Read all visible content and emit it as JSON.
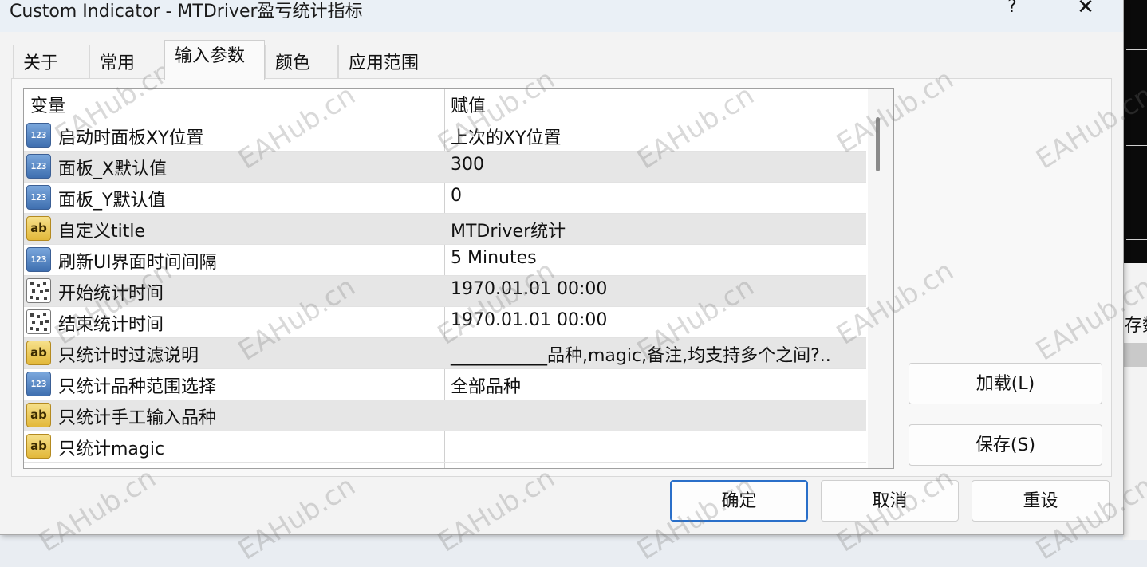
{
  "window": {
    "title": "Custom Indicator - MTDriver盈亏统计指标",
    "help_label": "?",
    "close_label": "✕"
  },
  "tabs": [
    {
      "label": "关于"
    },
    {
      "label": "常用"
    },
    {
      "label": "输入参数",
      "active": true
    },
    {
      "label": "颜色"
    },
    {
      "label": "应用范围"
    }
  ],
  "table": {
    "headers": {
      "variable": "变量",
      "value": "赋值"
    },
    "rows": [
      {
        "icon": "number-icon",
        "name": "启动时面板XY位置",
        "value": "上次的XY位置"
      },
      {
        "icon": "number-icon",
        "name": "面板_X默认值",
        "value": "300"
      },
      {
        "icon": "number-icon",
        "name": "面板_Y默认值",
        "value": "0"
      },
      {
        "icon": "string-icon",
        "name": "自定义title",
        "value": "MTDriver统计"
      },
      {
        "icon": "number-icon",
        "name": "刷新UI界面时间间隔",
        "value": "5 Minutes"
      },
      {
        "icon": "datetime-icon",
        "name": "开始统计时间",
        "value": "1970.01.01 00:00"
      },
      {
        "icon": "datetime-icon",
        "name": "结束统计时间",
        "value": "1970.01.01 00:00"
      },
      {
        "icon": "string-icon",
        "name": "只统计时过滤说明",
        "value": "___________品种,magic,备注,均支持多个之间?.."
      },
      {
        "icon": "number-icon",
        "name": "只统计品种范围选择",
        "value": "全部品种"
      },
      {
        "icon": "string-icon",
        "name": "只统计手工输入品种",
        "value": ""
      },
      {
        "icon": "string-icon",
        "name": "只统计magic",
        "value": ""
      }
    ]
  },
  "icon_glyphs": {
    "number": "123",
    "string": "ab"
  },
  "side_buttons": {
    "load": "加载(L)",
    "save": "保存(S)"
  },
  "footer_buttons": {
    "ok": "确定",
    "cancel": "取消",
    "reset": "重设"
  },
  "background_app": {
    "partial_text": "存数"
  },
  "watermark": {
    "text": "EAHub.cn"
  },
  "colors": {
    "accent": "#2a6fc9",
    "row_alt": "#e6e6e6",
    "titlebar": "#eaf0f6"
  }
}
